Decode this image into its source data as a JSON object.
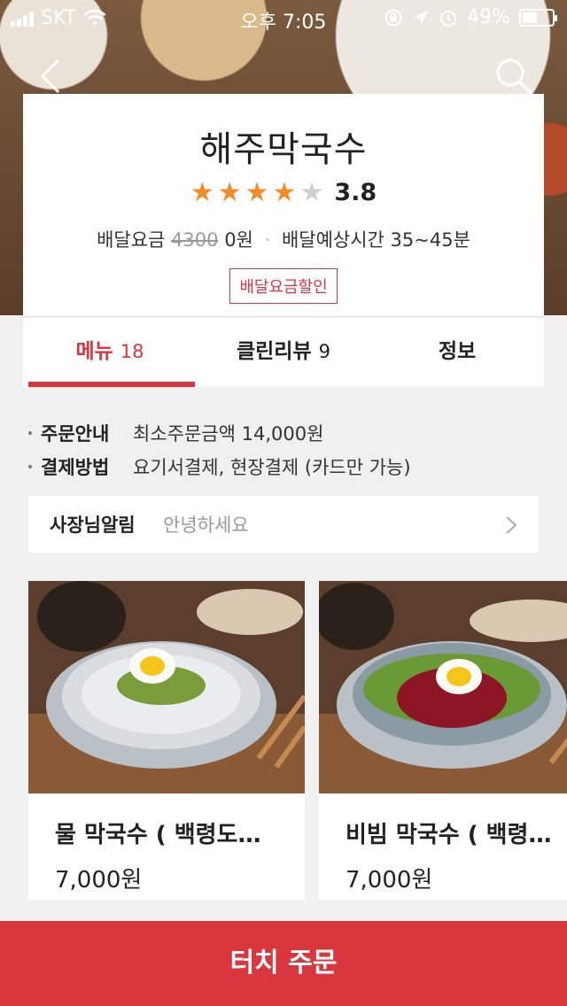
{
  "status": {
    "carrier": "SKT",
    "time": "오후 7:05",
    "battery": "49%",
    "battery_level": 0.49
  },
  "nav": {
    "back_icon": "chevron-left-icon",
    "search_icon": "search-icon"
  },
  "restaurant": {
    "name": "해주막국수",
    "rating_value": 3.8,
    "rating_text": "3.8",
    "delivery_fee_label": "배달요금",
    "delivery_fee_original": "4300",
    "delivery_fee_now": "0원",
    "delivery_time_label": "배달예상시간",
    "delivery_time": "35~45분",
    "badge": "배달요금할인"
  },
  "tabs": [
    {
      "label": "메뉴",
      "count": "18",
      "active": true
    },
    {
      "label": "클린리뷰",
      "count": "9",
      "active": false
    },
    {
      "label": "정보",
      "count": "",
      "active": false
    }
  ],
  "info": [
    {
      "key": "주문안내",
      "value": "최소주문금액 14,000원"
    },
    {
      "key": "결제방법",
      "value": "요기서결제, 현장결제 (카드만 가능)"
    }
  ],
  "notice": {
    "label": "사장님알림",
    "text": "안녕하세요"
  },
  "menu_items": [
    {
      "name": "물 막국수 ( 백령도…",
      "price": "7,000원"
    },
    {
      "name": "비빔 막국수 ( 백령…",
      "price": "7,000원"
    }
  ],
  "order_button": "터치 주문",
  "colors": {
    "accent": "#d9363e",
    "star": "#f28c28"
  }
}
